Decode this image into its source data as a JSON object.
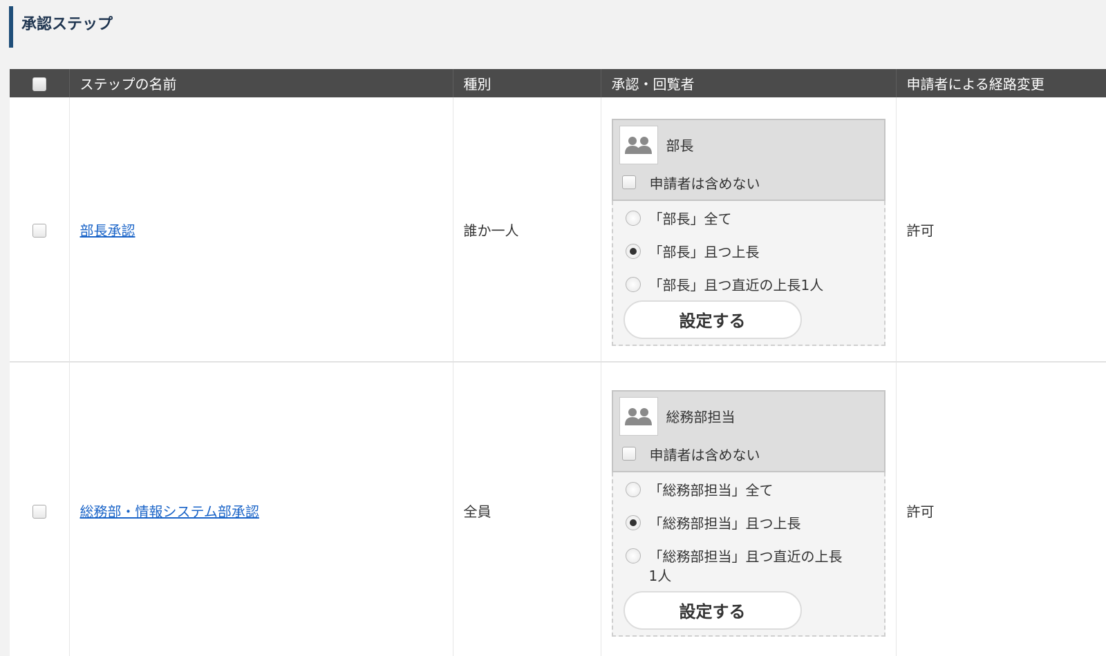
{
  "section_title": "承認ステップ",
  "table": {
    "headers": {
      "name": "ステップの名前",
      "type": "種別",
      "approvers": "承認・回覧者",
      "route_change": "申請者による経路変更"
    },
    "rows": [
      {
        "name": "部長承認",
        "type": "誰か一人",
        "approver": {
          "group": "部長",
          "exclude_applicant_label": "申請者は含めない",
          "options": [
            {
              "label": "「部長」全て",
              "selected": false
            },
            {
              "label": "「部長」且つ上長",
              "selected": true
            },
            {
              "label": "「部長」且つ直近の上長1人",
              "selected": false
            }
          ],
          "set_button": "設定する"
        },
        "route_change": "許可"
      },
      {
        "name": "総務部・情報システム部承認",
        "type": "全員",
        "approver": {
          "group": "総務部担当",
          "exclude_applicant_label": "申請者は含めない",
          "options": [
            {
              "label": "「総務部担当」全て",
              "selected": false
            },
            {
              "label": "「総務部担当」且つ上長",
              "selected": true
            },
            {
              "label": "「総務部担当」且つ直近の上長1人",
              "selected": false
            }
          ],
          "set_button": "設定する"
        },
        "route_change": "許可"
      }
    ]
  }
}
